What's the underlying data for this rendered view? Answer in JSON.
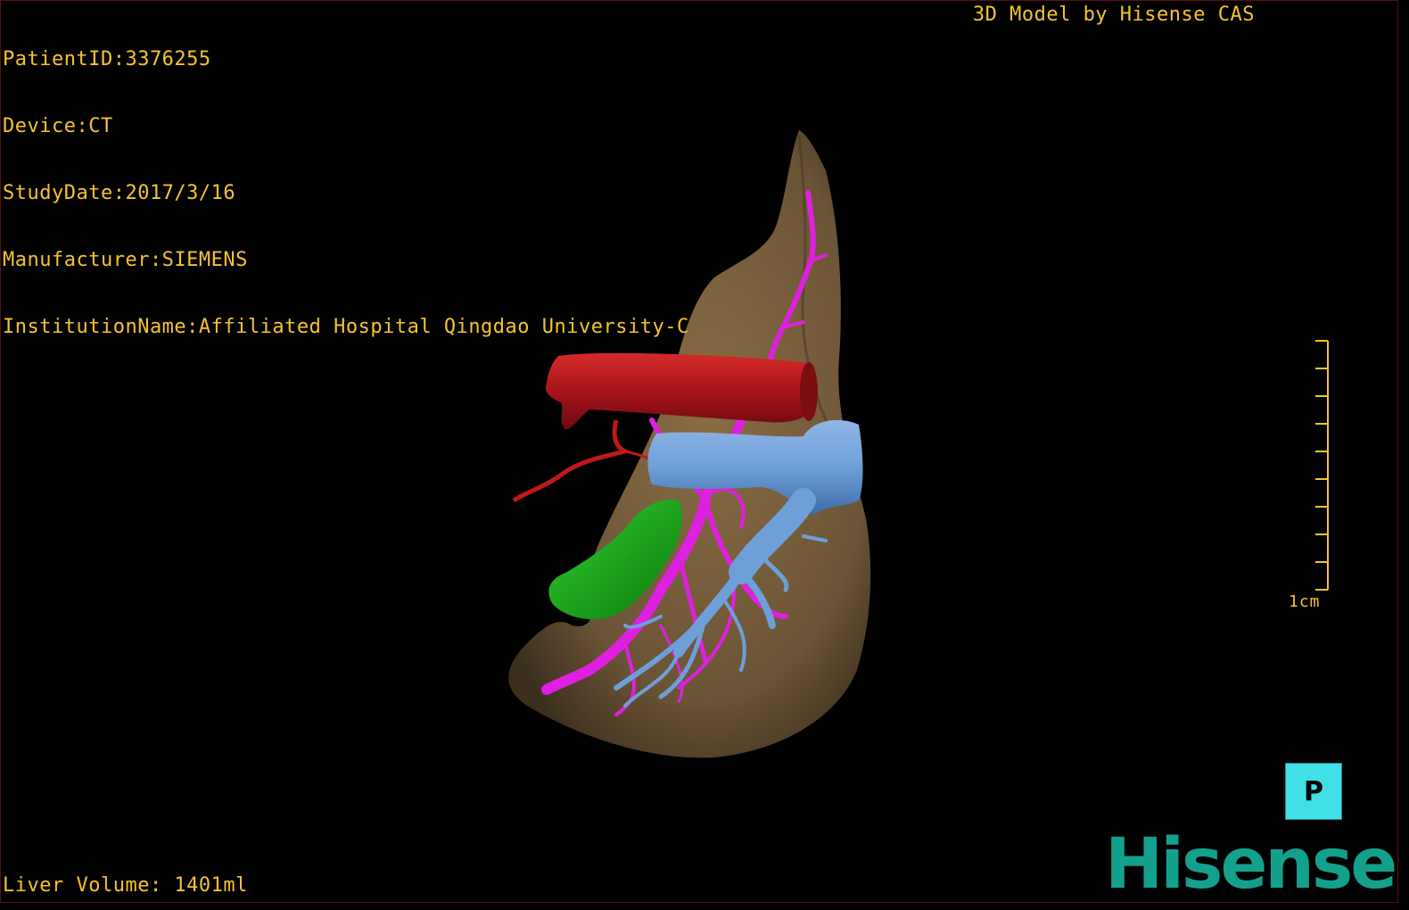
{
  "patient_info": {
    "patient_id": "PatientID:3376255",
    "device": "Device:CT",
    "study_date": "StudyDate:2017/3/16",
    "manufacturer": "Manufacturer:SIEMENS",
    "institution": "InstitutionName:Affiliated Hospital Qingdao University-C"
  },
  "brand_caption": "3D Model by Hisense CAS",
  "volume_readout": "Liver Volume: 1401ml",
  "scale": {
    "label": "1cm"
  },
  "orientation": {
    "label": "P"
  },
  "logo": "Hisense",
  "colors": {
    "text": "#f4c430",
    "liver": "#6b5436",
    "artery": "#b3161a",
    "portal_vein": "#e020e0",
    "hepatic_vein": "#6f9fd8",
    "gallbladder": "#1fae1f",
    "logo": "#13a08c",
    "orientation_cube": "#40e0e6"
  }
}
